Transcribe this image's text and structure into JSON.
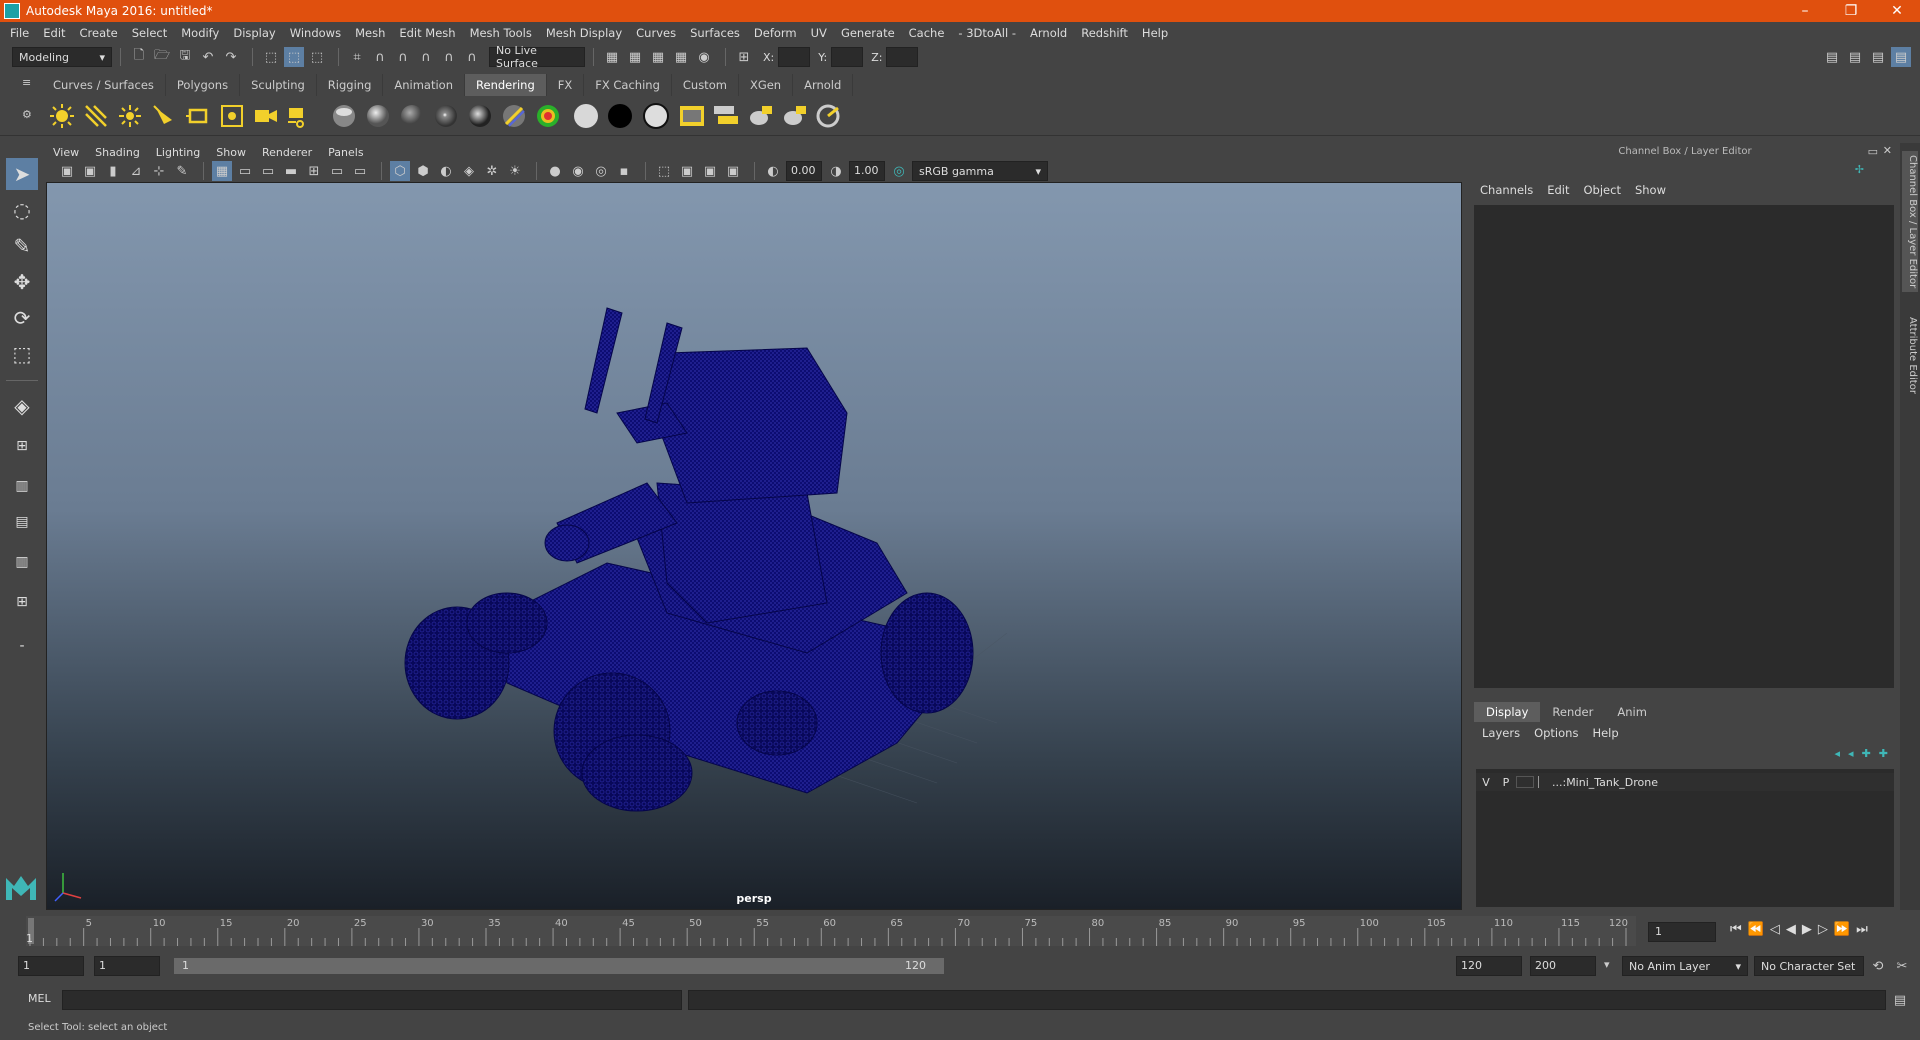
{
  "title": "Autodesk Maya 2016: untitled*",
  "window_controls": {
    "minimize": "–",
    "restore": "❐",
    "close": "✕"
  },
  "menu": [
    "File",
    "Edit",
    "Create",
    "Select",
    "Modify",
    "Display",
    "Windows",
    "Mesh",
    "Edit Mesh",
    "Mesh Tools",
    "Mesh Display",
    "Curves",
    "Surfaces",
    "Deform",
    "UV",
    "Generate",
    "Cache",
    "- 3DtoAll -",
    "Arnold",
    "Redshift",
    "Help"
  ],
  "status": {
    "mode": "Modeling",
    "live_surface": "No Live Surface",
    "x_label": "X:",
    "y_label": "Y:",
    "z_label": "Z:"
  },
  "shelf_tabs": [
    "Curves / Surfaces",
    "Polygons",
    "Sculpting",
    "Rigging",
    "Animation",
    "Rendering",
    "FX",
    "FX Caching",
    "Custom",
    "XGen",
    "Arnold"
  ],
  "active_shelf_tab": "Rendering",
  "viewport": {
    "menu": [
      "View",
      "Shading",
      "Lighting",
      "Show",
      "Renderer",
      "Panels"
    ],
    "exposure": "0.00",
    "gamma": "1.00",
    "color_space": "sRGB gamma",
    "camera": "persp"
  },
  "channel_box": {
    "title": "Channel Box / Layer Editor",
    "menu": [
      "Channels",
      "Edit",
      "Object",
      "Show"
    ]
  },
  "layer_editor": {
    "tabs": [
      "Display",
      "Render",
      "Anim"
    ],
    "active_tab": "Display",
    "menu": [
      "Layers",
      "Options",
      "Help"
    ],
    "layers": [
      {
        "v": "V",
        "p": "P",
        "name": "...:Mini_Tank_Drone"
      }
    ]
  },
  "side_tabs": [
    "Channel Box / Layer Editor",
    "Attribute Editor"
  ],
  "timeline": {
    "ticks": [
      "5",
      "10",
      "15",
      "20",
      "25",
      "30",
      "35",
      "40",
      "45",
      "50",
      "55",
      "60",
      "65",
      "70",
      "75",
      "80",
      "85",
      "90",
      "95",
      "100",
      "105",
      "110",
      "115",
      "120"
    ],
    "start_marker": "1",
    "current_frame": "1"
  },
  "range": {
    "start": "1",
    "playback_start": "1",
    "slider_start": "1",
    "slider_end": "120",
    "playback_end": "120",
    "end": "200",
    "anim_layer": "No Anim Layer",
    "character_set": "No Character Set"
  },
  "command": {
    "label": "MEL"
  },
  "help_line": "Select Tool: select an object",
  "colors": {
    "titlebar": "#e0500e",
    "wireframe": "#0a0a6e",
    "accent_teal": "#5cc8c8"
  }
}
